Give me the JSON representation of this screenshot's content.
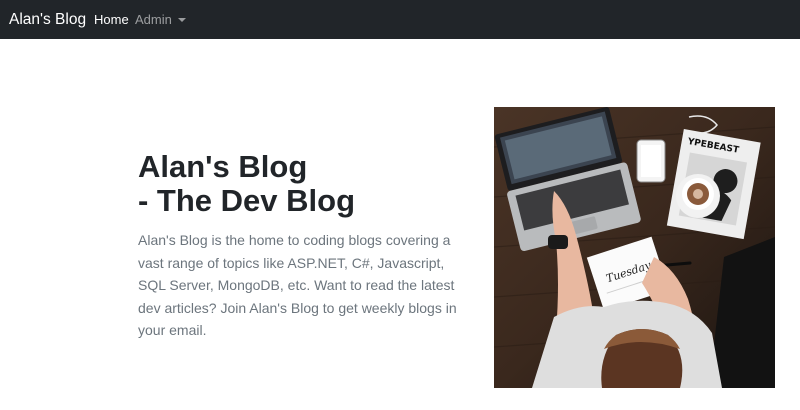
{
  "navbar": {
    "brand": "Alan's Blog",
    "links": [
      {
        "label": "Home",
        "active": true
      },
      {
        "label": "Admin",
        "has_dropdown": true
      }
    ],
    "background": "#212529"
  },
  "hero": {
    "title_line1": "Alan's Blog",
    "title_line2": "- The Dev Blog",
    "description": "Alan's Blog is the home to coding blogs covering a vast range of topics like ASP.NET, C#, Javascript, SQL Server, MongoDB, etc. Want to read the latest dev articles? Join Alan's Blog to get weekly blogs in your email.",
    "image": {
      "magazine_text": "YPEBEAST",
      "notebook_text": "Tuesday"
    }
  }
}
